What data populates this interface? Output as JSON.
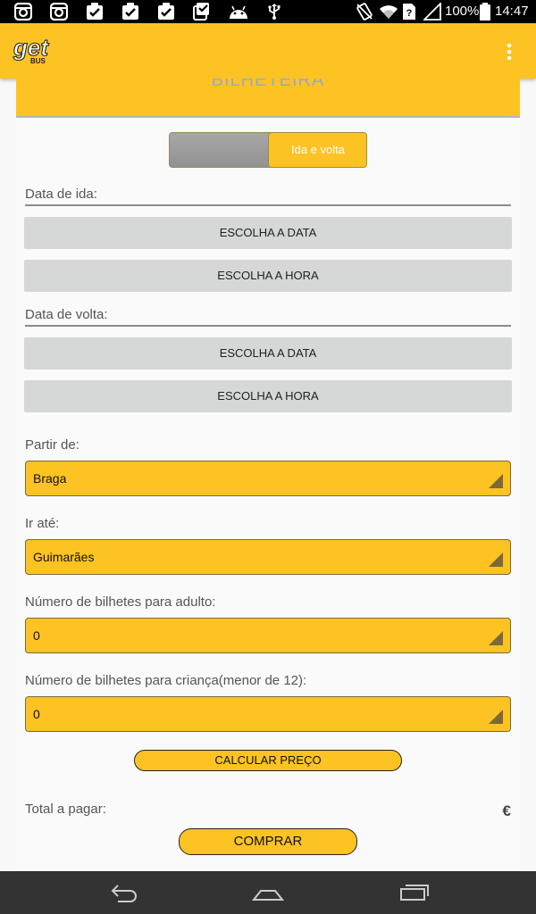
{
  "status_bar": {
    "battery_text": "100%",
    "time": "14:47",
    "left_icons": [
      "instagram-icon",
      "instagram-icon",
      "clipboard-check-icon",
      "clipboard-check-icon",
      "clipboard-check-icon",
      "photo-check-icon",
      "android-icon",
      "usb-icon"
    ],
    "right_icons": [
      "vibrate-icon",
      "wifi-icon",
      "sim-icon",
      "signal-icon",
      "battery-icon"
    ]
  },
  "app_bar": {
    "logo_icon": "getbus-logo-icon",
    "menu_icon": "overflow-menu-icon",
    "brand_color": "#fdc323"
  },
  "form": {
    "header_text": "BILHETEIRA",
    "toggle": {
      "selected_label": "Ida e volta"
    },
    "departure": {
      "label": "Data de ida:",
      "date_button": "ESCOLHA A DATA",
      "time_button": "ESCOLHA A HORA"
    },
    "return": {
      "label": "Data de volta:",
      "date_button": "ESCOLHA A DATA",
      "time_button": "ESCOLHA A HORA"
    },
    "from": {
      "label": "Partir de:",
      "value": "Braga"
    },
    "to": {
      "label": "Ir até:",
      "value": "Guimarães"
    },
    "adult_tickets": {
      "label": "Número de bilhetes para adulto:",
      "value": "0"
    },
    "child_tickets": {
      "label": "Número de bilhetes para criança(menor de 12):",
      "value": "0"
    },
    "calculate_button": "CALCULAR PREÇO",
    "total_label": "Total a pagar:",
    "currency": "€",
    "buy_button": "COMPRAR"
  },
  "nav_bar": {
    "icons": [
      "back-icon",
      "home-icon",
      "recent-apps-icon"
    ]
  }
}
